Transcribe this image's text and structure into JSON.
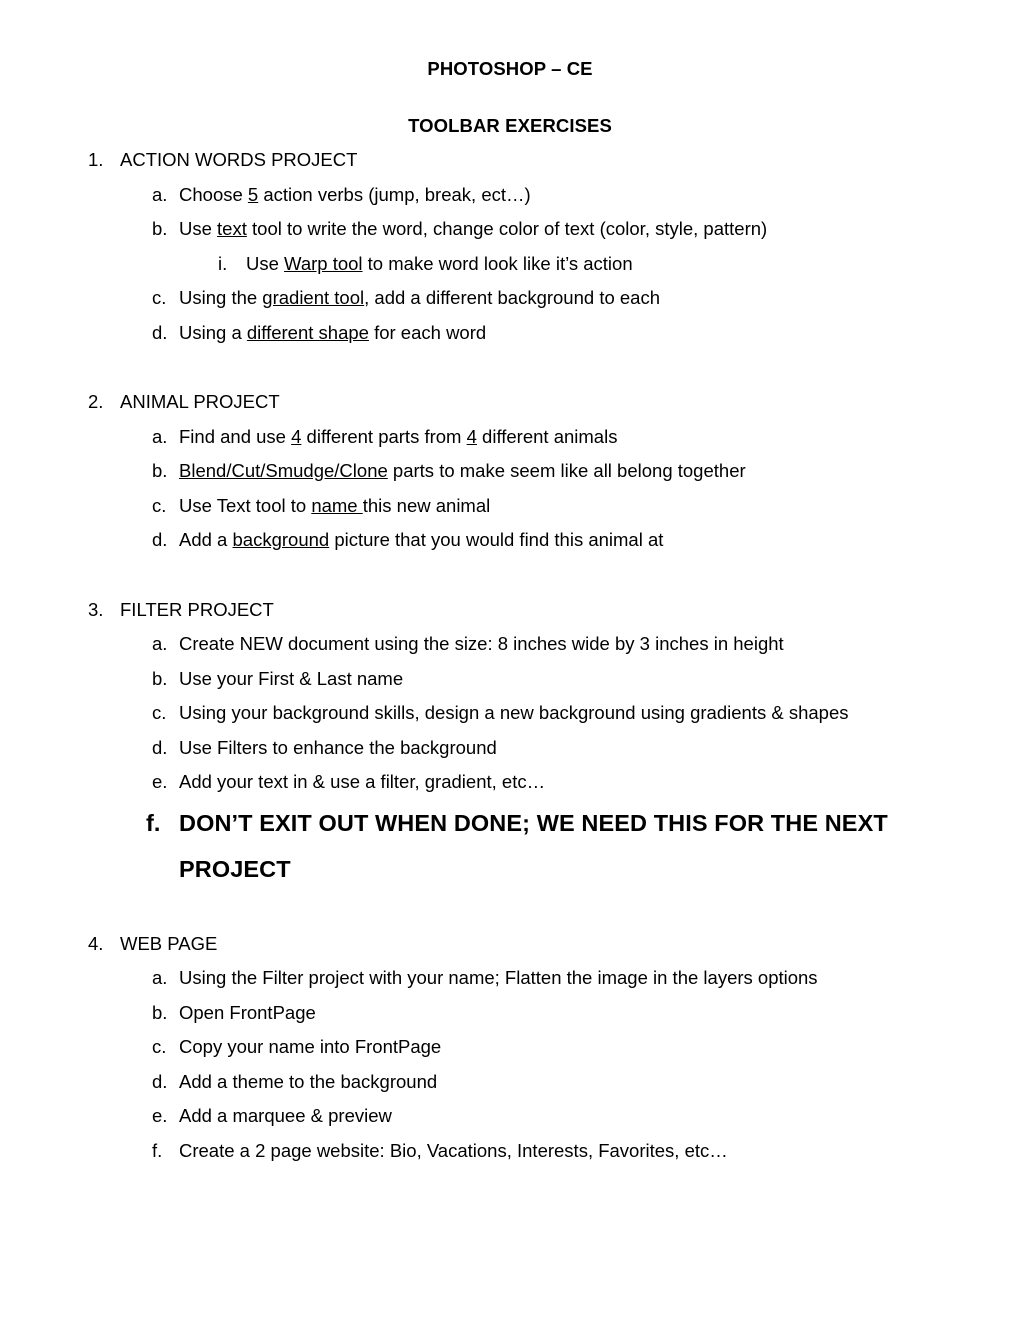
{
  "document": {
    "title_line_1": "PHOTOSHOP – CE",
    "title_line_2": "TOOLBAR EXERCISES"
  },
  "sections": [
    {
      "marker": "1.",
      "heading": "ACTION WORDS PROJECT",
      "items": [
        {
          "marker": "a.",
          "level": 2,
          "parts": [
            {
              "text": "Choose ",
              "underline": false
            },
            {
              "text": "5",
              "underline": true
            },
            {
              "text": " action verbs (jump, break, ect…)",
              "underline": false
            }
          ]
        },
        {
          "marker": "b.",
          "level": 2,
          "parts": [
            {
              "text": "Use ",
              "underline": false
            },
            {
              "text": "text",
              "underline": true
            },
            {
              "text": " tool to write the word, change color of text (color, style, pattern)",
              "underline": false
            }
          ]
        },
        {
          "marker": "i.",
          "level": 3,
          "parts": [
            {
              "text": "Use ",
              "underline": false
            },
            {
              "text": "Warp tool",
              "underline": true
            },
            {
              "text": " to make word look like it’s action",
              "underline": false
            }
          ]
        },
        {
          "marker": "c.",
          "level": 2,
          "parts": [
            {
              "text": "Using the ",
              "underline": false
            },
            {
              "text": "gradient tool",
              "underline": true
            },
            {
              "text": ", add a different background to each",
              "underline": false
            }
          ]
        },
        {
          "marker": "d.",
          "level": 2,
          "parts": [
            {
              "text": "Using a ",
              "underline": false
            },
            {
              "text": "different shape",
              "underline": true
            },
            {
              "text": " for each word",
              "underline": false
            }
          ]
        }
      ]
    },
    {
      "marker": "2.",
      "heading": "ANIMAL PROJECT",
      "items": [
        {
          "marker": "a.",
          "level": 2,
          "parts": [
            {
              "text": "Find and use ",
              "underline": false
            },
            {
              "text": "4",
              "underline": true
            },
            {
              "text": " different parts from ",
              "underline": false
            },
            {
              "text": "4",
              "underline": true
            },
            {
              "text": " different animals",
              "underline": false
            }
          ]
        },
        {
          "marker": "b.",
          "level": 2,
          "parts": [
            {
              "text": "Blend/Cut/Smudge/Clone",
              "underline": true
            },
            {
              "text": " parts to make seem like all belong together",
              "underline": false
            }
          ]
        },
        {
          "marker": "c.",
          "level": 2,
          "parts": [
            {
              "text": "Use Text tool to ",
              "underline": false
            },
            {
              "text": "name ",
              "underline": true
            },
            {
              "text": "this new animal",
              "underline": false
            }
          ]
        },
        {
          "marker": "d.",
          "level": 2,
          "parts": [
            {
              "text": "Add a ",
              "underline": false
            },
            {
              "text": "background",
              "underline": true
            },
            {
              "text": " picture that you would find this animal at",
              "underline": false
            }
          ]
        }
      ]
    },
    {
      "marker": "3.",
      "heading": "FILTER PROJECT",
      "items": [
        {
          "marker": "a.",
          "level": 2,
          "parts": [
            {
              "text": "Create NEW document using the size: 8 inches wide by 3 inches in height",
              "underline": false
            }
          ]
        },
        {
          "marker": "b.",
          "level": 2,
          "parts": [
            {
              "text": "Use your First & Last name",
              "underline": false
            }
          ]
        },
        {
          "marker": "c.",
          "level": 2,
          "parts": [
            {
              "text": "Using your background skills, design a new background using gradients & shapes",
              "underline": false
            }
          ]
        },
        {
          "marker": "d.",
          "level": 2,
          "parts": [
            {
              "text": "Use Filters to enhance the background",
              "underline": false
            }
          ]
        },
        {
          "marker": "e.",
          "level": 2,
          "parts": [
            {
              "text": "Add your text in & use a filter, gradient, etc…",
              "underline": false
            }
          ]
        },
        {
          "marker": "f.",
          "level": 2,
          "emphasis": "large-bold",
          "parts": [
            {
              "text": "DON’T EXIT OUT WHEN DONE; WE NEED THIS FOR THE NEXT PROJECT",
              "underline": false
            }
          ]
        }
      ]
    },
    {
      "marker": "4.",
      "heading": "WEB PAGE",
      "items": [
        {
          "marker": "a.",
          "level": 2,
          "parts": [
            {
              "text": "Using the Filter project with your name; Flatten the image in the layers options",
              "underline": false
            }
          ]
        },
        {
          "marker": "b.",
          "level": 2,
          "parts": [
            {
              "text": "Open FrontPage",
              "underline": false
            }
          ]
        },
        {
          "marker": "c.",
          "level": 2,
          "parts": [
            {
              "text": "Copy your name into FrontPage",
              "underline": false
            }
          ]
        },
        {
          "marker": "d.",
          "level": 2,
          "parts": [
            {
              "text": "Add a theme to the background",
              "underline": false
            }
          ]
        },
        {
          "marker": "e.",
          "level": 2,
          "parts": [
            {
              "text": "Add a marquee & preview",
              "underline": false
            }
          ]
        },
        {
          "marker": "f.",
          "level": 2,
          "parts": [
            {
              "text": "Create a 2 page website: Bio, Vacations, Interests, Favorites, etc…",
              "underline": false
            }
          ]
        }
      ]
    }
  ]
}
